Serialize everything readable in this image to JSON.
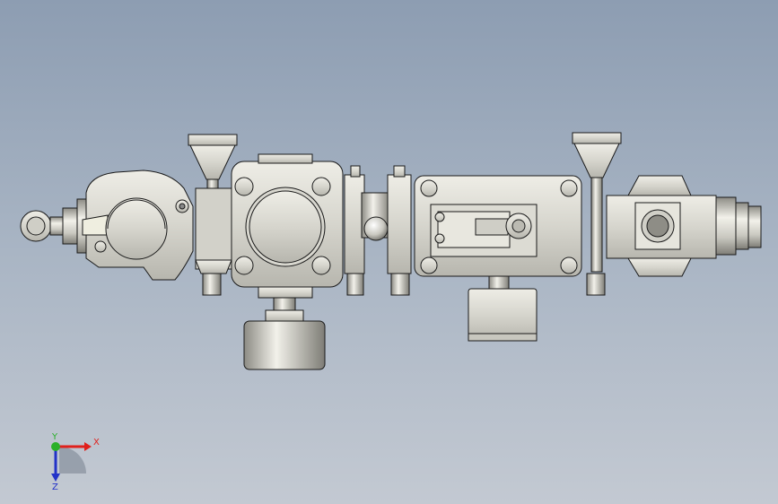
{
  "viewport": {
    "background_top": "#8d9db2",
    "background_bottom": "#c3c9d2",
    "model_fill": "#d9d8d0",
    "model_edge": "#1a1a1a"
  },
  "triad": {
    "x_label": "X",
    "y_label": "Y",
    "z_label": "Z",
    "x_color": "#e0201c",
    "y_color": "#2ab02a",
    "z_color": "#2232c8"
  }
}
